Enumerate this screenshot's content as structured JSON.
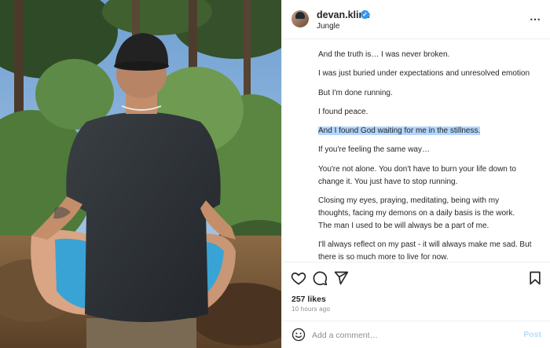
{
  "post": {
    "username": "devan.kline",
    "verified_mark": "✓",
    "location": "Jungle",
    "more_icon": "⋯",
    "likes": "257 likes",
    "time_ago": "10 hours ago"
  },
  "caption": [
    {
      "text": "And the truth is… I was never broken.",
      "highlighted": false
    },
    {
      "text": "I was just buried under expectations and unresolved emotion",
      "highlighted": false
    },
    {
      "text": "But I'm done running.",
      "highlighted": false
    },
    {
      "text": "I found peace.",
      "highlighted": false
    },
    {
      "text": "And I found God waiting for me in the stillness.",
      "highlighted": true
    },
    {
      "text": "If you're feeling the same way…",
      "highlighted": false
    },
    {
      "text": "You're not alone. You don't have to burn your life down to change it. You just have to stop running.",
      "highlighted": false
    },
    {
      "text": "Closing my eyes, praying, meditating, being with my thoughts, facing my demons on a daily basis is the work.",
      "highlighted": false
    },
    {
      "text": "The man I used to be will always be a part of me.",
      "highlighted": false
    },
    {
      "text": "I'll always reflect on my past - it will always make me sad. But there is so much more to live for now.",
      "highlighted": false
    }
  ],
  "comment": {
    "placeholder": "Add a comment…",
    "post_label": "Post"
  },
  "icons": {
    "like": "heart-icon",
    "comment": "comment-icon",
    "share": "share-icon",
    "save": "bookmark-icon",
    "emoji": "emoji-icon",
    "more": "more-icon"
  },
  "colors": {
    "highlight": "#b4d5fe",
    "verified": "#3897f0",
    "post_button": "#b2dffc",
    "muted": "#8e8e8e"
  }
}
